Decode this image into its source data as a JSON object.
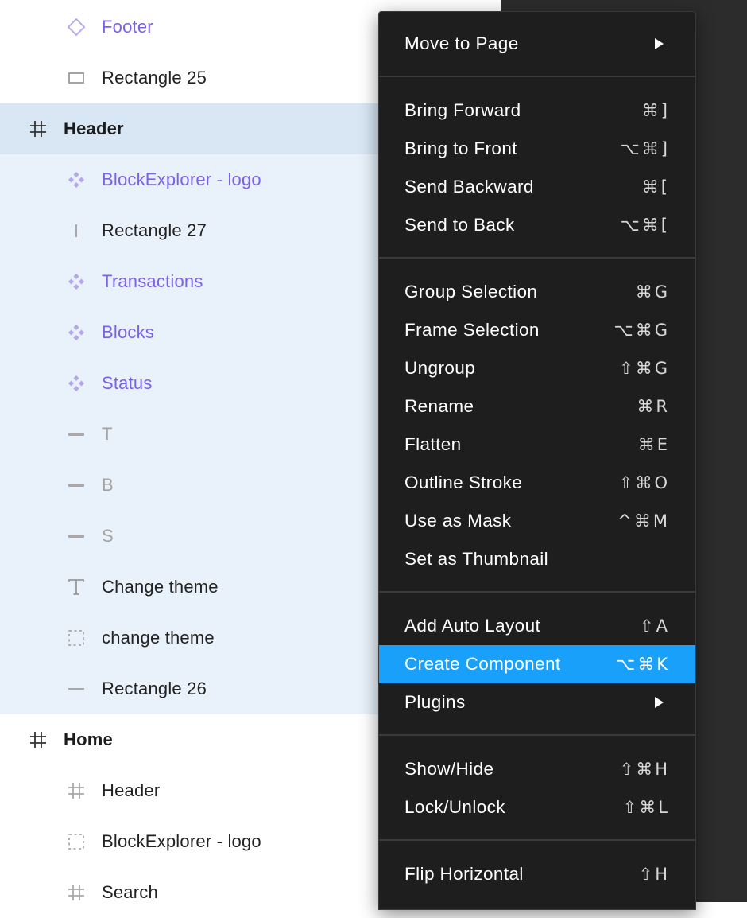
{
  "layers": [
    {
      "label": "Footer",
      "icon": "component-instance-icon"
    },
    {
      "label": "Rectangle 25",
      "icon": "rectangle-icon"
    },
    {
      "label": "Header",
      "icon": "frame-icon"
    },
    {
      "label": "BlockExplorer - logo",
      "icon": "component-icon"
    },
    {
      "label": "Rectangle 27",
      "icon": "vertical-line-icon"
    },
    {
      "label": "Transactions",
      "icon": "component-icon"
    },
    {
      "label": "Blocks",
      "icon": "component-icon"
    },
    {
      "label": "Status",
      "icon": "component-icon"
    },
    {
      "label": "T",
      "icon": "bar-icon"
    },
    {
      "label": "B",
      "icon": "bar-icon"
    },
    {
      "label": "S",
      "icon": "bar-icon"
    },
    {
      "label": "Change theme",
      "icon": "text-icon"
    },
    {
      "label": "change theme",
      "icon": "dashed-frame-icon"
    },
    {
      "label": "Rectangle 26",
      "icon": "line-icon"
    },
    {
      "label": "Home",
      "icon": "frame-icon"
    },
    {
      "label": "Header",
      "icon": "frame-icon"
    },
    {
      "label": "BlockExplorer - logo",
      "icon": "dashed-frame-icon"
    },
    {
      "label": "Search",
      "icon": "frame-icon"
    }
  ],
  "menu": {
    "sections": [
      [
        {
          "label": "Move to Page",
          "submenu": true
        }
      ],
      [
        {
          "label": "Bring Forward",
          "shortcut": "⌘]"
        },
        {
          "label": "Bring to Front",
          "shortcut": "⌥⌘]"
        },
        {
          "label": "Send Backward",
          "shortcut": "⌘["
        },
        {
          "label": "Send to Back",
          "shortcut": "⌥⌘["
        }
      ],
      [
        {
          "label": "Group Selection",
          "shortcut": "⌘G"
        },
        {
          "label": "Frame Selection",
          "shortcut": "⌥⌘G"
        },
        {
          "label": "Ungroup",
          "shortcut": "⇧⌘G"
        },
        {
          "label": "Rename",
          "shortcut": "⌘R"
        },
        {
          "label": "Flatten",
          "shortcut": "⌘E"
        },
        {
          "label": "Outline Stroke",
          "shortcut": "⇧⌘O"
        },
        {
          "label": "Use as Mask",
          "shortcut": "^⌘M"
        },
        {
          "label": "Set as Thumbnail",
          "shortcut": ""
        }
      ],
      [
        {
          "label": "Add Auto Layout",
          "shortcut": "⇧A"
        },
        {
          "label": "Create Component",
          "shortcut": "⌥⌘K",
          "highlighted": true
        },
        {
          "label": "Plugins",
          "submenu": true
        }
      ],
      [
        {
          "label": "Show/Hide",
          "shortcut": "⇧⌘H"
        },
        {
          "label": "Lock/Unlock",
          "shortcut": "⇧⌘L"
        }
      ],
      [
        {
          "label": "Flip Horizontal",
          "shortcut": "⇧H"
        }
      ]
    ]
  },
  "colors": {
    "accent": "#18a0fb",
    "component_purple": "#7b61e8",
    "menu_bg": "#1e1e1e",
    "selection_bg": "#d9e7f5",
    "child_bg": "#e9f2fb"
  }
}
